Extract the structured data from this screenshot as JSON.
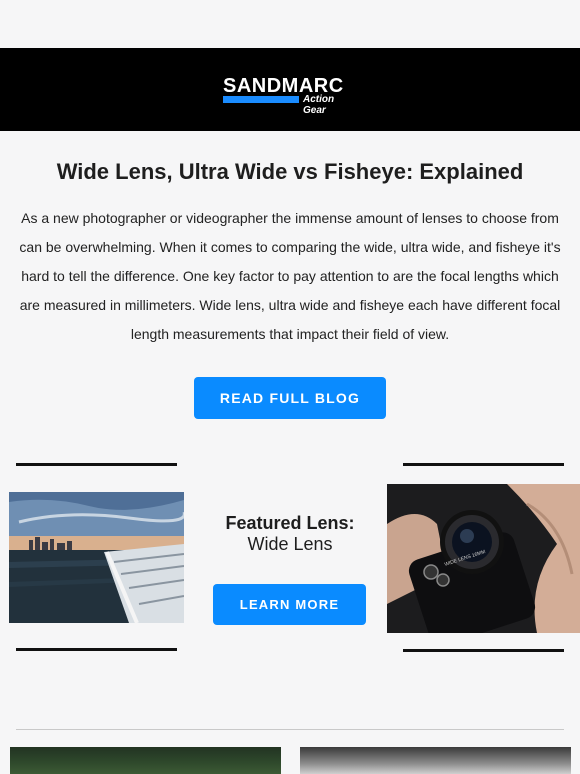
{
  "header": {
    "brand": "SANDMARC",
    "tagline": "Action Gear"
  },
  "article": {
    "title": "Wide Lens, Ultra Wide vs Fisheye: Explained",
    "intro": "As a new photographer or videographer the immense amount of lenses to choose from can be overwhelming. When it comes to comparing the wide, ultra wide, and fisheye it's hard to tell the difference. One key factor to pay attention to are the focal lengths which are measured in millimeters. Wide lens, ultra wide and fisheye each have different focal length measurements that impact their field of view.",
    "cta_label": "READ FULL BLOG"
  },
  "featured": {
    "heading": "Featured Lens:",
    "lens_name": "Wide Lens",
    "cta_label": "LEARN MORE",
    "lens_engraving": "WIDE LENS 16MM"
  },
  "colors": {
    "accent": "#0a8bff",
    "header_bg": "#000000",
    "page_bg": "#f6f6f7"
  }
}
